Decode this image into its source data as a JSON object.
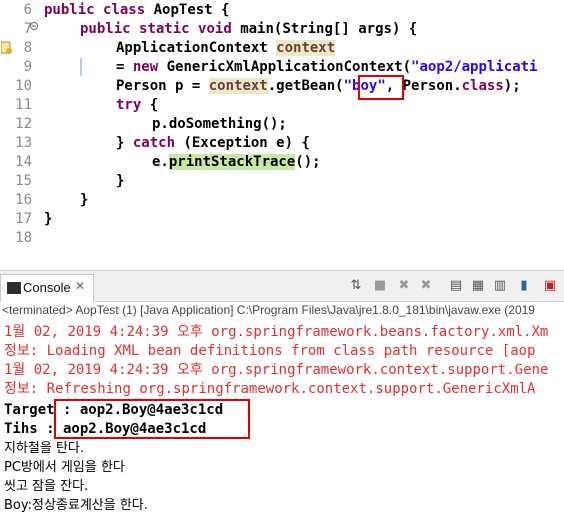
{
  "editor": {
    "line_numbers": [
      "6",
      "7",
      "8",
      "9",
      "10",
      "11",
      "12",
      "13",
      "14",
      "15",
      "16",
      "17",
      "18"
    ],
    "lines": {
      "l6": {
        "kw1": "public",
        "kw2": "class",
        "name": "AopTest",
        "brace": " {"
      },
      "l7": {
        "kw1": "public",
        "kw2": "static",
        "kw3": "void",
        "fn": "main",
        "p1": "(",
        "type": "String",
        "p2": "[] ",
        "arg": "args",
        "p3": ") {"
      },
      "l8": {
        "type": "ApplicationContext",
        "var": "context"
      },
      "l9": {
        "eq": "= ",
        "kw": "new",
        "type": "GenericXmlApplicationContext",
        "p1": "(",
        "str": "\"aop2/applicati"
      },
      "l10": {
        "type": "Person",
        "rest1": " p = ",
        "var": "context",
        "rest2": ".getBean(",
        "str": "\"boy\"",
        "rest3": ", Person.",
        "kw": "class",
        "rest4": ");"
      },
      "l11": {
        "kw": "try",
        "rest": " {"
      },
      "l12": {
        "text": "p.doSomething();"
      },
      "l13": {
        "p1": "} ",
        "kw": "catch",
        "p2": " (",
        "type": "Exception",
        "p3": " e) {"
      },
      "l14": {
        "p1": "e.",
        "fn": "printStackTrace",
        "p2": "();"
      },
      "l15": {
        "text": "}"
      },
      "l16": {
        "text": "}"
      },
      "l17": {
        "text": "}"
      }
    }
  },
  "console": {
    "tab_label": "Console",
    "tab_close": "✕",
    "status": "<terminated> AopTest (1) [Java Application] C:\\Program Files\\Java\\jre1.8.0_181\\bin\\javaw.exe (2019",
    "output": [
      "1월 02, 2019 4:24:39 오후 org.springframework.beans.factory.xml.Xm",
      "정보: Loading XML bean definitions from class path resource [aop",
      "1월 02, 2019 4:24:39 오후 org.springframework.context.support.Gene",
      "정보: Refreshing org.springframework.context.support.GenericXmlA",
      "Target : aop2.Boy@4ae3c1cd",
      "Tihs : aop2.Boy@4ae3c1cd",
      "지하철을 탄다.",
      "PC방에서 게임을 한다",
      "씻고 잠을 잔다.",
      "Boy:정상종료계산을 한다."
    ]
  },
  "colors": {
    "keyword": "#7f0055",
    "string": "#2a00ff",
    "error": "#e03030",
    "highlight_box": "#e00000"
  }
}
